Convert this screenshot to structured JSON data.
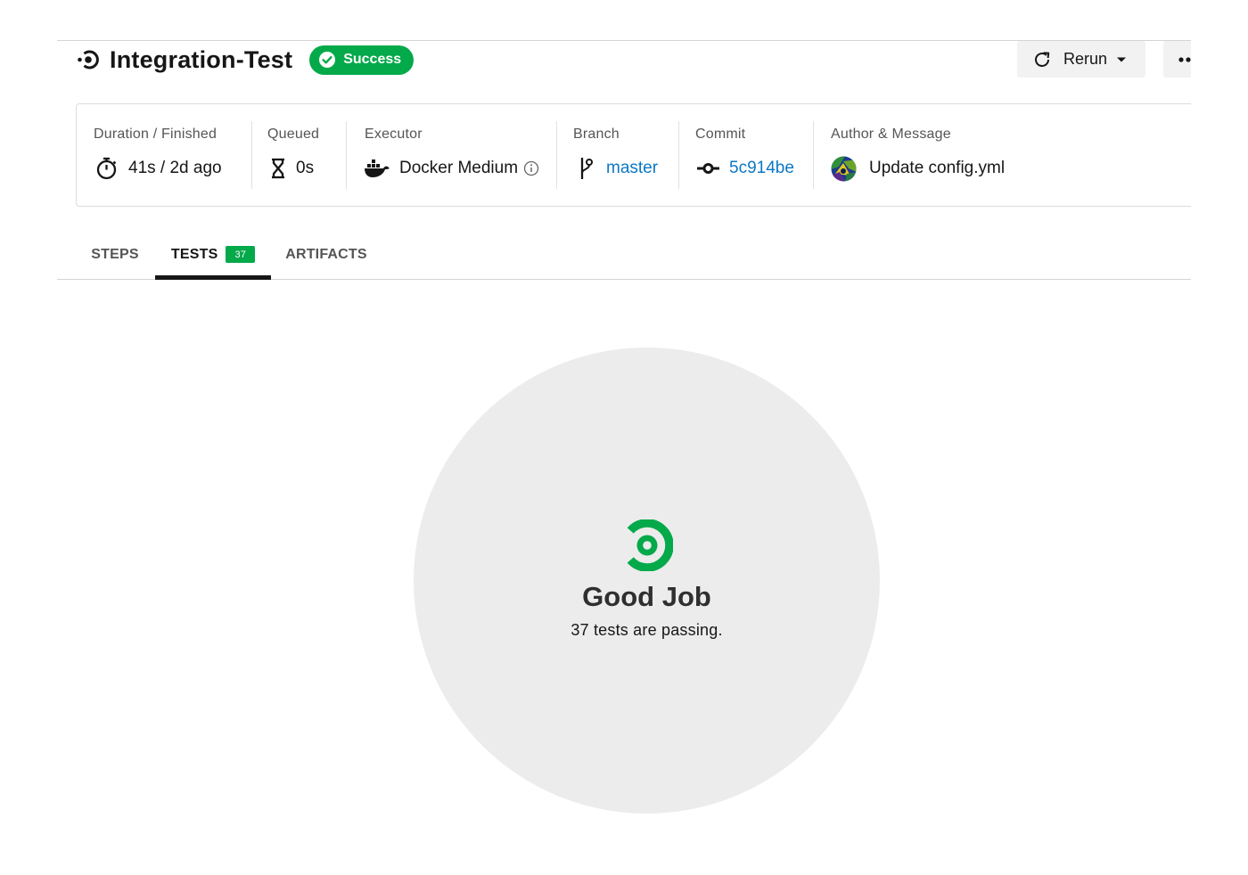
{
  "job": {
    "title": "Integration-Test",
    "status": "Success",
    "icon": "circleci-job-icon"
  },
  "actions": {
    "rerun_label": "Rerun",
    "more_icon": "more-dots-icon"
  },
  "meta": {
    "duration": {
      "label": "Duration / Finished",
      "value": "41s / 2d ago",
      "icon": "stopwatch-icon"
    },
    "queued": {
      "label": "Queued",
      "value": "0s",
      "icon": "hourglass-icon"
    },
    "executor": {
      "label": "Executor",
      "value": "Docker Medium",
      "icon": "docker-icon"
    },
    "branch": {
      "label": "Branch",
      "value": "master",
      "icon": "branch-icon"
    },
    "commit": {
      "label": "Commit",
      "value": "5c914be",
      "icon": "commit-icon"
    },
    "author": {
      "label": "Author & Message",
      "value": "Update config.yml",
      "icon": "avatar"
    }
  },
  "tabs": [
    {
      "label": "STEPS",
      "active": false
    },
    {
      "label": "TESTS",
      "active": true,
      "count": "37"
    },
    {
      "label": "ARTIFACTS",
      "active": false
    }
  ],
  "result": {
    "title": "Good Job",
    "subtitle": "37 tests are passing."
  },
  "colors": {
    "success": "#04a94a",
    "link": "#0b78c5",
    "text": "#161616",
    "muted": "#555555",
    "circle_bg": "#ececec"
  }
}
